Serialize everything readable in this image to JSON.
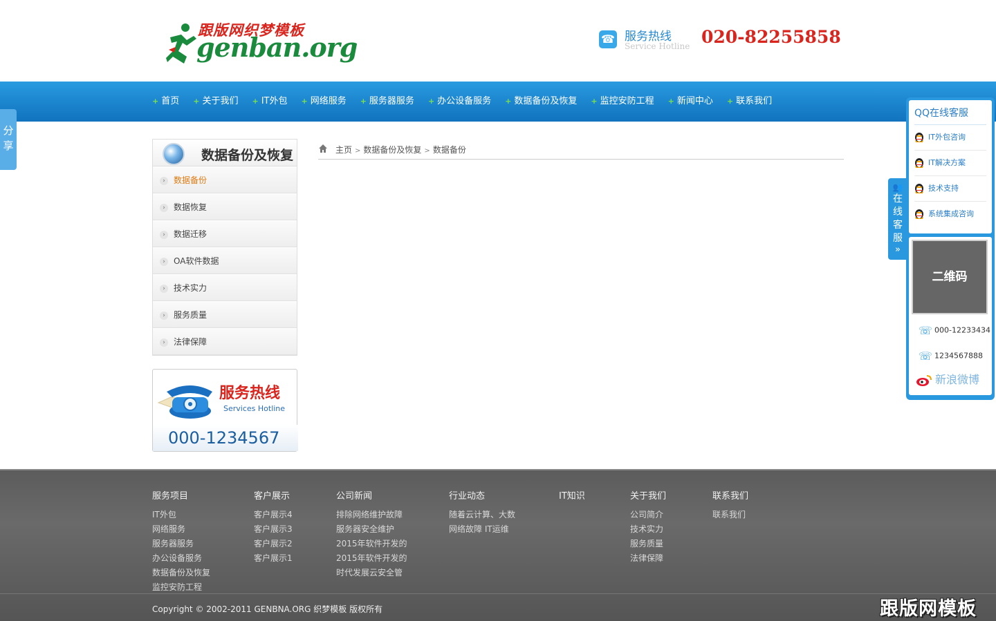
{
  "logo": {
    "cn_text": "跟版网织梦模板",
    "en_text": "genban.org"
  },
  "hotline": {
    "title": "服务热线",
    "subtitle": "Service Hotline",
    "number": "020-82255858"
  },
  "nav": {
    "items": [
      {
        "label": "首页"
      },
      {
        "label": "关于我们"
      },
      {
        "label": "IT外包"
      },
      {
        "label": "网络服务"
      },
      {
        "label": "服务器服务"
      },
      {
        "label": "办公设备服务"
      },
      {
        "label": "数据备份及恢复"
      },
      {
        "label": "监控安防工程"
      },
      {
        "label": "新闻中心"
      },
      {
        "label": "联系我们"
      }
    ]
  },
  "share": {
    "label_1": "分",
    "label_2": "享"
  },
  "sidebar": {
    "title": "数据备份及恢复",
    "items": [
      {
        "label": "数据备份"
      },
      {
        "label": "数据恢复"
      },
      {
        "label": "数据迁移"
      },
      {
        "label": "OA软件数据"
      },
      {
        "label": "技术实力"
      },
      {
        "label": "服务质量"
      },
      {
        "label": "法律保障"
      }
    ]
  },
  "hotline_box": {
    "title": "服务热线",
    "subtitle": "Services Hotline",
    "number": "000-1234567"
  },
  "breadcrumb": {
    "home": "主页",
    "sep": ">",
    "level1": "数据备份及恢复",
    "level2": "数据备份"
  },
  "float_tab": {
    "chars": [
      "在",
      "线",
      "客",
      "服"
    ],
    "arrows": "»"
  },
  "float_panel": {
    "title": "QQ在线客服",
    "qq_items": [
      {
        "label": "IT外包咨询"
      },
      {
        "label": "IT解决方案"
      },
      {
        "label": "技术支持"
      },
      {
        "label": "系统集成咨询"
      }
    ],
    "qr_label": "二维码",
    "phone_1": "000-12233434",
    "phone_2": "1234567888",
    "weibo": "新浪微博"
  },
  "footer": {
    "columns": [
      {
        "head": "服务项目",
        "links": [
          "IT外包",
          "网络服务",
          "服务器服务",
          "办公设备服务",
          "数据备份及恢复",
          "监控安防工程"
        ]
      },
      {
        "head": "客户展示",
        "links": [
          "客户展示4",
          "客户展示3",
          "客户展示2",
          "客户展示1"
        ]
      },
      {
        "head": "公司新闻",
        "links": [
          "排除网络维护故障",
          "服务器安全维护",
          "2015年软件开发的",
          "2015年软件开发的",
          "时代发展云安全管"
        ]
      },
      {
        "head": "行业动态",
        "links": [
          "随着云计算、大数",
          "网络故障 IT运维"
        ]
      },
      {
        "head": "IT知识",
        "links": []
      },
      {
        "head": "关于我们",
        "links": [
          "公司简介",
          "技术实力",
          "服务质量",
          "法律保障"
        ]
      },
      {
        "head": "联系我们",
        "links": [
          "联系我们"
        ]
      }
    ],
    "copyright": "Copyright © 2002-2011 GENBNA.ORG 织梦模板 版权所有",
    "watermark": "跟版网模板"
  },
  "colors": {
    "nav_blue": "#1c86cf",
    "hotline_red": "#d9251d",
    "active_orange": "#e07b12",
    "panel_blue": "#2a98de"
  }
}
